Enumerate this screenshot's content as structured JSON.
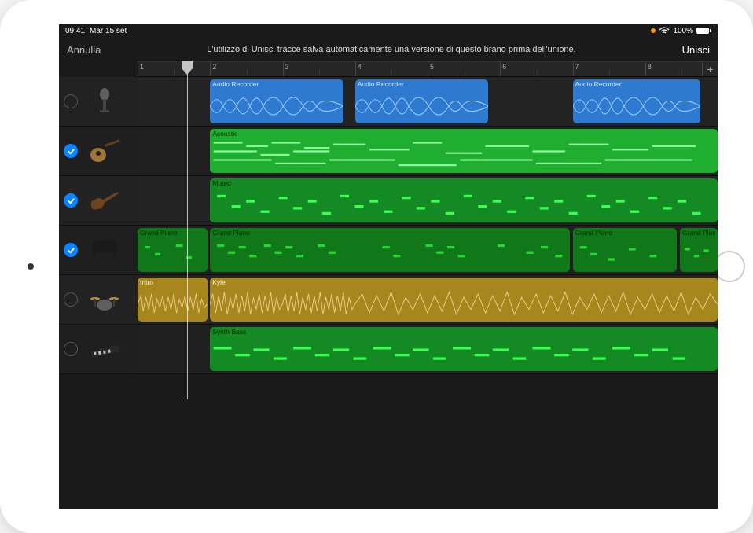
{
  "status": {
    "time": "09:41",
    "date": "Mar 15 set",
    "battery_pct": "100%"
  },
  "topbar": {
    "cancel": "Annulla",
    "message": "L'utilizzo di Unisci tracce salva automaticamente una versione di questo brano prima dell'unione.",
    "merge": "Unisci"
  },
  "ruler": {
    "bars": [
      "1",
      "2",
      "3",
      "4",
      "5",
      "6",
      "7",
      "8"
    ],
    "add_symbol": "+"
  },
  "tracks": [
    {
      "icon": "mic",
      "selected": false
    },
    {
      "icon": "acoustic-guitar",
      "selected": true
    },
    {
      "icon": "bass-guitar",
      "selected": true
    },
    {
      "icon": "piano",
      "selected": true
    },
    {
      "icon": "drums",
      "selected": false
    },
    {
      "icon": "keyboard-synth",
      "selected": false
    }
  ],
  "regions": {
    "track0": [
      {
        "label": "Audio Recorder",
        "start_pct": 12.5,
        "width_pct": 23
      },
      {
        "label": "Audio Recorder",
        "start_pct": 37.5,
        "width_pct": 23
      },
      {
        "label": "Audio Recorder",
        "start_pct": 75,
        "width_pct": 22
      }
    ],
    "track1": [
      {
        "label": "Acoustic",
        "start_pct": 12.5,
        "width_pct": 87.5
      }
    ],
    "track2": [
      {
        "label": "Muted",
        "start_pct": 12.5,
        "width_pct": 87.5
      }
    ],
    "track3": [
      {
        "label": "Grand Piano",
        "start_pct": 0,
        "width_pct": 12
      },
      {
        "label": "Grand Piano",
        "start_pct": 12.5,
        "width_pct": 62
      },
      {
        "label": "Grand Piano",
        "start_pct": 75,
        "width_pct": 18
      },
      {
        "label": "Grand Piano",
        "start_pct": 93.5,
        "width_pct": 6.5
      }
    ],
    "track4": [
      {
        "label": "Intro",
        "start_pct": 0,
        "width_pct": 12
      },
      {
        "label": "Kyle",
        "start_pct": 12.5,
        "width_pct": 87.5
      }
    ],
    "track5": [
      {
        "label": "Synth Bass",
        "start_pct": 12.5,
        "width_pct": 87.5
      }
    ]
  }
}
